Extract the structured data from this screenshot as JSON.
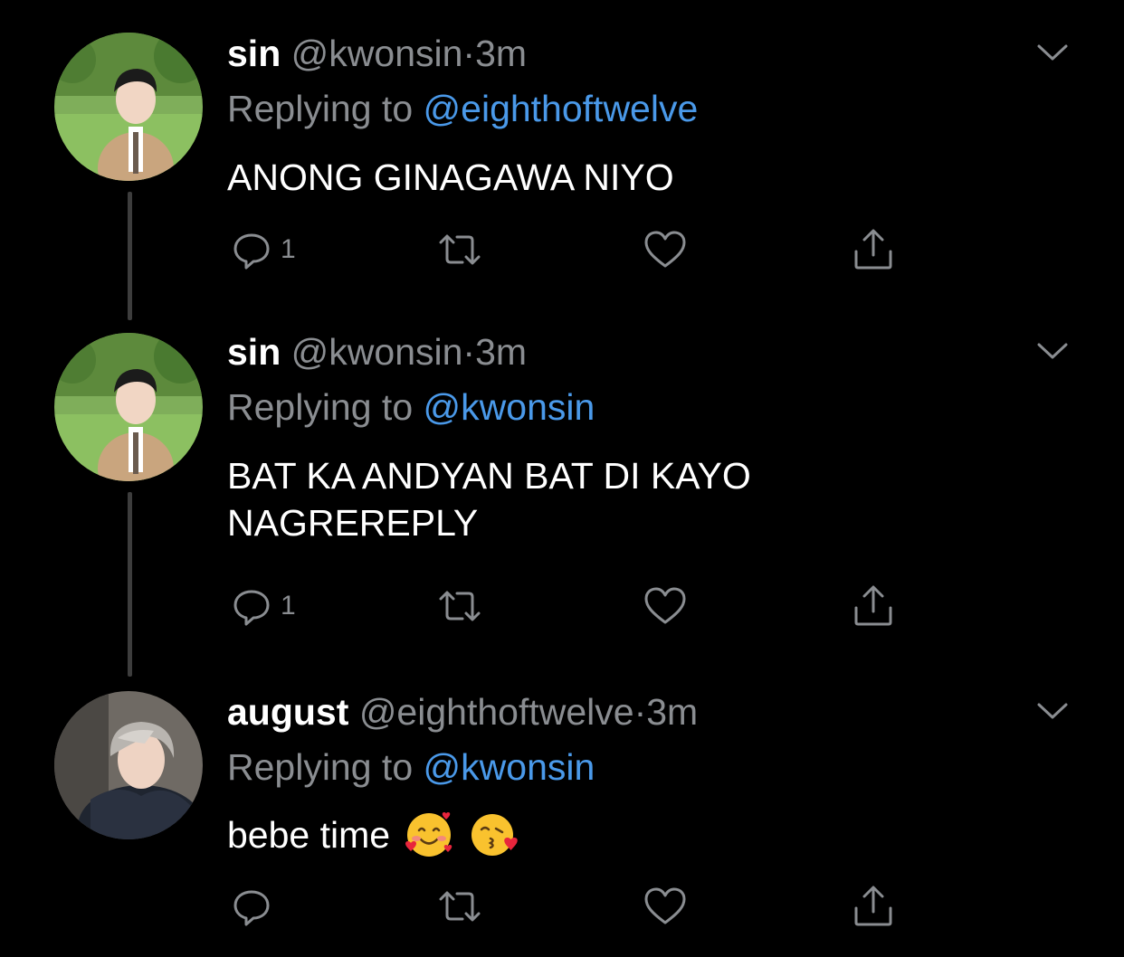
{
  "tweets": [
    {
      "display_name": "sin",
      "handle": "@kwonsin",
      "separator": "·",
      "time": "3m",
      "replying_prefix": "Replying to",
      "replying_to": "@eighthoftwelve",
      "body_lines": [
        "ANONG GINAGAWA NIYO"
      ],
      "reply_count": "1",
      "avatar_icon": "avatar-photo-icon"
    },
    {
      "display_name": "sin",
      "handle": "@kwonsin",
      "separator": "·",
      "time": "3m",
      "replying_prefix": "Replying to",
      "replying_to": "@kwonsin",
      "body_lines": [
        "BAT KA ANDYAN BAT DI KAYO",
        "NAGREREPLY"
      ],
      "reply_count": "1",
      "avatar_icon": "avatar-photo-icon"
    },
    {
      "display_name": "august",
      "handle": "@eighthoftwelve",
      "separator": "·",
      "time": "3m",
      "replying_prefix": "Replying to",
      "replying_to": "@kwonsin",
      "body_lines": [
        "bebe time"
      ],
      "body_emojis": [
        "smiling-face-with-hearts-emoji",
        "face-blowing-kiss-emoji"
      ],
      "reply_count": "",
      "avatar_icon": "avatar-photo-icon"
    }
  ],
  "icons": {
    "reply": "reply-icon",
    "retweet": "retweet-icon",
    "like": "like-icon",
    "share": "share-icon",
    "more": "chevron-down-icon"
  },
  "colors": {
    "background": "#000000",
    "text": "#ffffff",
    "secondary": "#8a8d91",
    "link": "#4a99e9",
    "thread_line": "#3d3d3d"
  }
}
